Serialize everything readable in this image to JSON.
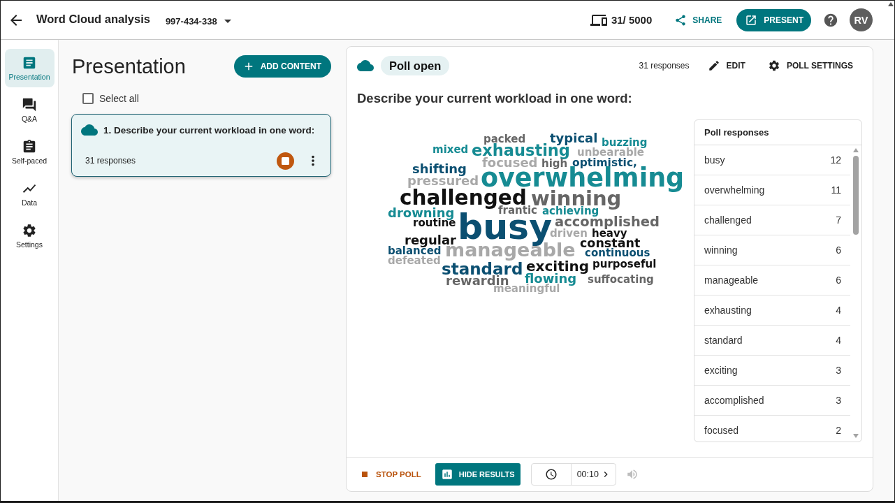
{
  "header": {
    "title": "Word Cloud analysis",
    "session_code": "997-434-338",
    "participants": "31/ 5000",
    "share_label": "SHARE",
    "present_label": "PRESENT",
    "avatar_initials": "RV"
  },
  "nav": [
    {
      "kind": "presentation",
      "label": "Presentation",
      "selected": true
    },
    {
      "kind": "qa",
      "label": "Q&A",
      "selected": false
    },
    {
      "kind": "selfpaced",
      "label": "Self-paced",
      "selected": false
    },
    {
      "kind": "data",
      "label": "Data",
      "selected": false
    },
    {
      "kind": "settings",
      "label": "Settings",
      "selected": false
    }
  ],
  "content_panel": {
    "title": "Presentation",
    "add_button": "ADD CONTENT",
    "select_all": {
      "label": "Select all",
      "checked": false
    },
    "items": [
      {
        "title": "1. Describe your current workload in one word:",
        "responses": "31 responses",
        "selected": true
      }
    ]
  },
  "poll": {
    "status": "Poll open",
    "responses": "31 responses",
    "edit_label": "EDIT",
    "settings_label": "POLL SETTINGS",
    "question": "Describe your current workload in one word:",
    "word_cloud": {
      "words": [
        {
          "text": "packed",
          "color": "#666666"
        },
        {
          "text": "typical",
          "color": "#0b4f71"
        },
        {
          "text": "buzzing",
          "color": "#168b93"
        },
        {
          "text": "mixed",
          "color": "#168b93"
        },
        {
          "text": "exhausting",
          "color": "#168b93"
        },
        {
          "text": "unbearable",
          "color": "#a8a8a8"
        },
        {
          "text": "focused",
          "color": "#a8a8a8"
        },
        {
          "text": "high",
          "color": "#666666"
        },
        {
          "text": "optimistic,",
          "color": "#0b4f71"
        },
        {
          "text": "shifting",
          "color": "#0b4f71"
        },
        {
          "text": "pressured",
          "color": "#a8a8a8"
        },
        {
          "text": "overwhelming",
          "color": "#168b93"
        },
        {
          "text": "challenged",
          "color": "#111111"
        },
        {
          "text": "winning",
          "color": "#666666"
        },
        {
          "text": "drowning",
          "color": "#168b93"
        },
        {
          "text": "frantic",
          "color": "#666666"
        },
        {
          "text": "achieving",
          "color": "#168b93"
        },
        {
          "text": "routine",
          "color": "#111111"
        },
        {
          "text": "busy",
          "color": "#0b4f71"
        },
        {
          "text": "accomplished",
          "color": "#666666"
        },
        {
          "text": "driven",
          "color": "#a8a8a8"
        },
        {
          "text": "heavy",
          "color": "#111111"
        },
        {
          "text": "regular",
          "color": "#111111"
        },
        {
          "text": "constant",
          "color": "#111111"
        },
        {
          "text": "balanced",
          "color": "#0b4f71"
        },
        {
          "text": "manageable",
          "color": "#a8a8a8"
        },
        {
          "text": "continuous",
          "color": "#0b4f71"
        },
        {
          "text": "defeated",
          "color": "#a8a8a8"
        },
        {
          "text": "standard",
          "color": "#0b4f71"
        },
        {
          "text": "exciting",
          "color": "#111111"
        },
        {
          "text": "purposeful",
          "color": "#111111"
        },
        {
          "text": "rewardin",
          "color": "#666666"
        },
        {
          "text": "flowing",
          "color": "#168b93"
        },
        {
          "text": "suffocating",
          "color": "#666666"
        },
        {
          "text": "meaningful",
          "color": "#a8a8a8"
        }
      ]
    },
    "responses_panel": {
      "title": "Poll responses",
      "rows": [
        {
          "word": "busy",
          "count": "12"
        },
        {
          "word": "overwhelming",
          "count": "11"
        },
        {
          "word": "challenged",
          "count": "7"
        },
        {
          "word": "winning",
          "count": "6"
        },
        {
          "word": "manageable",
          "count": "6"
        },
        {
          "word": "exhausting",
          "count": "4"
        },
        {
          "word": "standard",
          "count": "4"
        },
        {
          "word": "exciting",
          "count": "3"
        },
        {
          "word": "accomplished",
          "count": "3"
        },
        {
          "word": "focused",
          "count": "2"
        }
      ]
    },
    "footer": {
      "stop_label": "STOP POLL",
      "hide_label": "HIDE RESULTS",
      "timer": "00:10",
      "sound": {
        "disabled": true
      }
    }
  }
}
